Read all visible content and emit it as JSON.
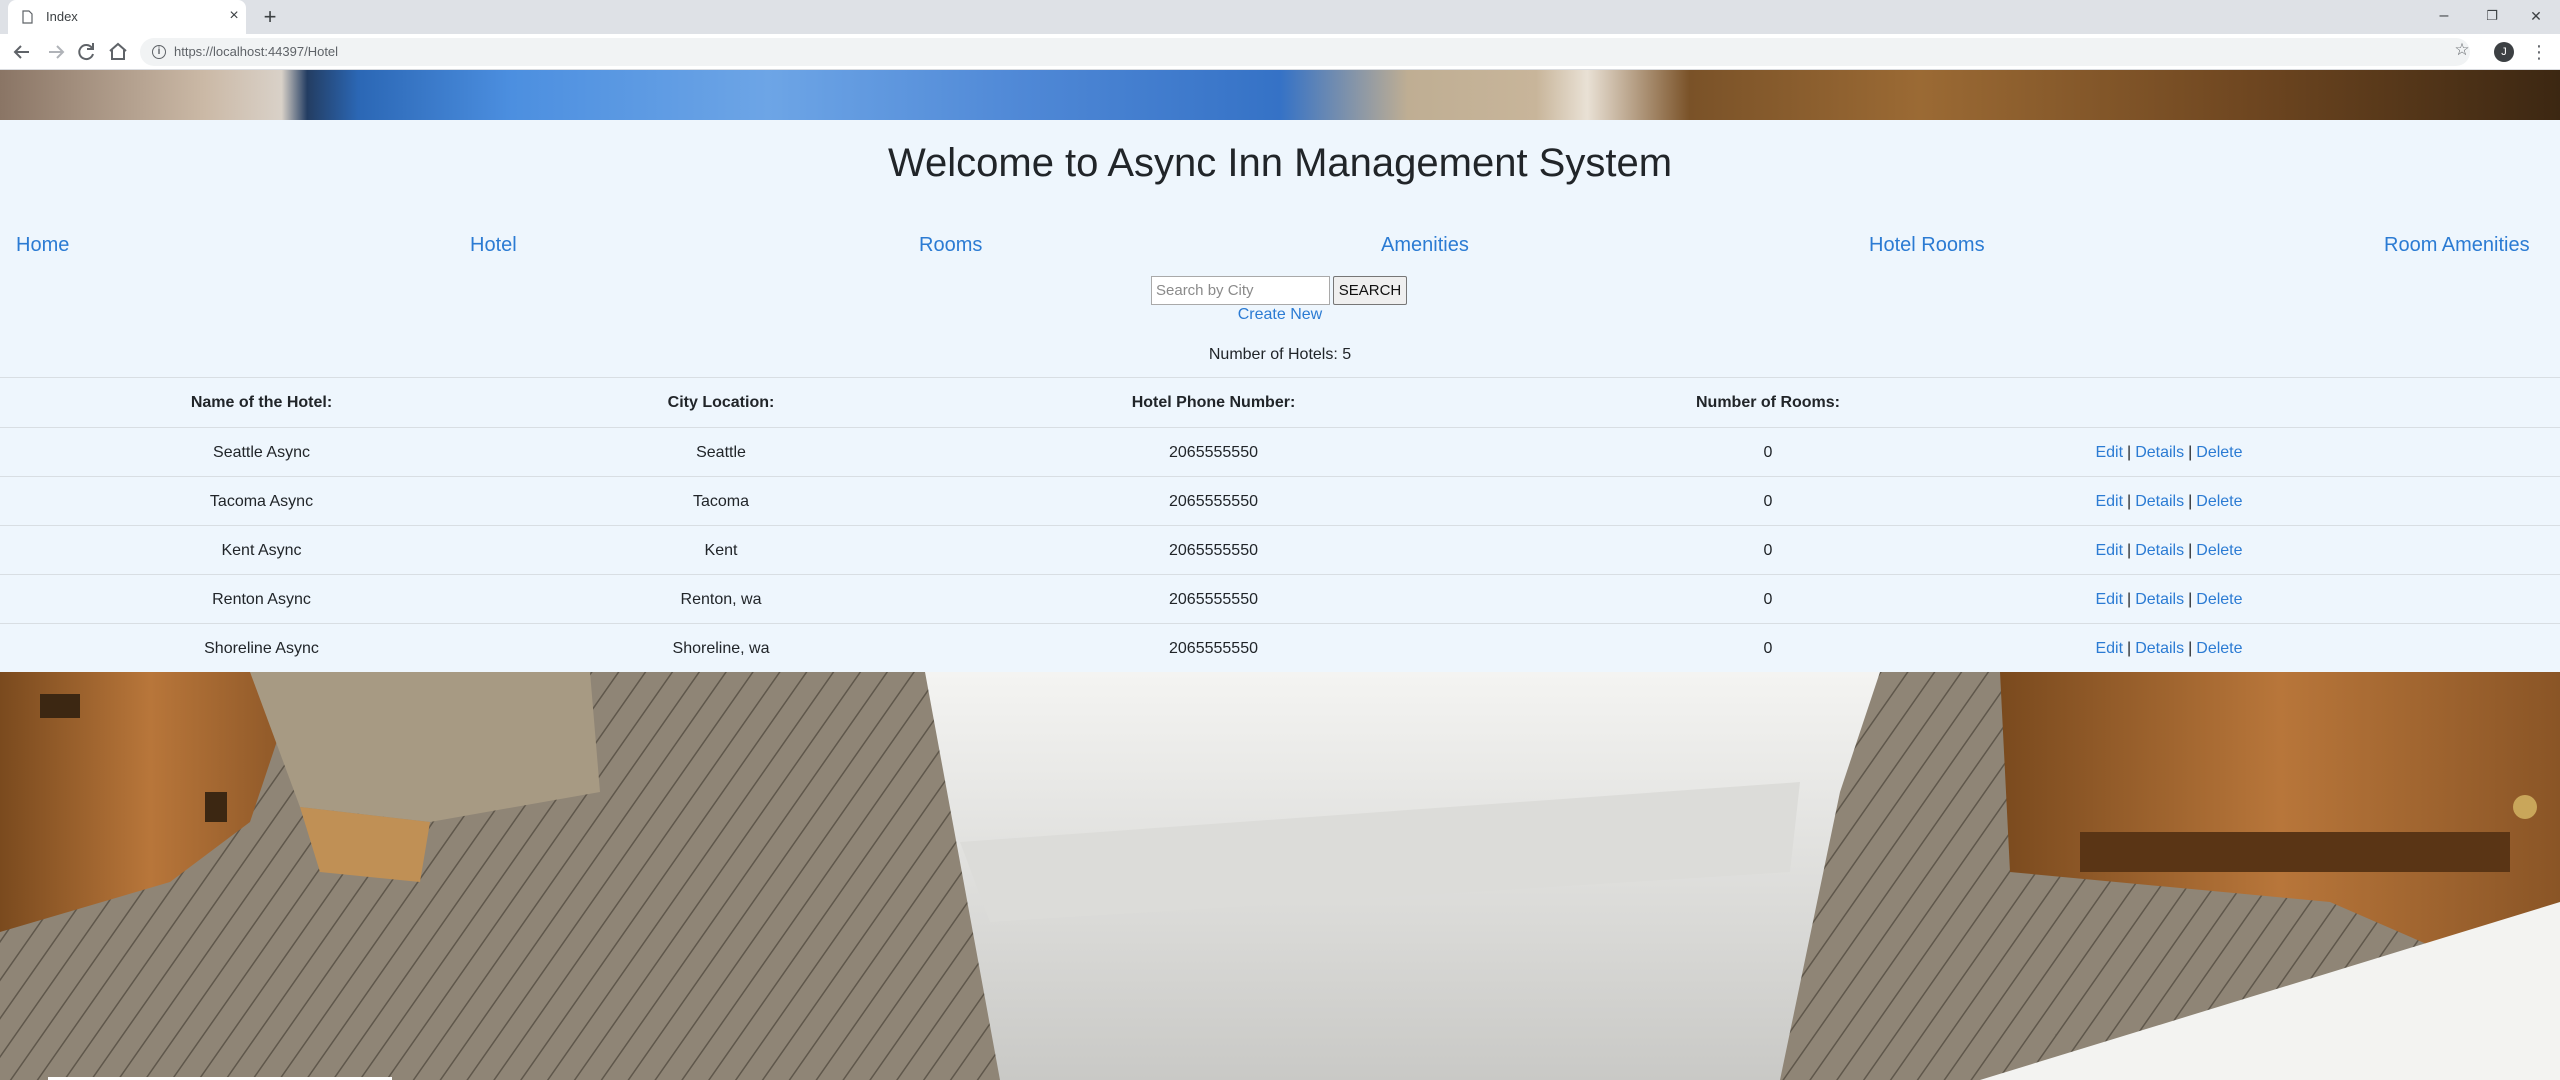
{
  "browser": {
    "tab_title": "Index",
    "tab_close": "×",
    "new_tab": "+",
    "url": "https://localhost:44397/Hotel",
    "profile_initial": "J",
    "window_controls": {
      "minimize": "–",
      "restore": "❐",
      "close": "✕"
    }
  },
  "page": {
    "title": "Welcome to Async Inn Management System",
    "nav": [
      {
        "label": "Home"
      },
      {
        "label": "Hotel"
      },
      {
        "label": "Rooms"
      },
      {
        "label": "Amenities"
      },
      {
        "label": "Hotel Rooms"
      },
      {
        "label": "Room Amenities"
      }
    ],
    "search": {
      "placeholder": "Search by City",
      "value": "",
      "button_label": "SEARCH"
    },
    "create_new": "Create New",
    "count_text": "Number of Hotels: 5",
    "table": {
      "headers": [
        "Name of the Hotel:",
        "City Location:",
        "Hotel Phone Number:",
        "Number of Rooms:"
      ],
      "rows": [
        {
          "name": "Seattle Async",
          "city": "Seattle",
          "phone": "2065555550",
          "rooms": "0"
        },
        {
          "name": "Tacoma Async",
          "city": "Tacoma",
          "phone": "2065555550",
          "rooms": "0"
        },
        {
          "name": "Kent Async",
          "city": "Kent",
          "phone": "2065555550",
          "rooms": "0"
        },
        {
          "name": "Renton Async",
          "city": "Renton, wa",
          "phone": "2065555550",
          "rooms": "0"
        },
        {
          "name": "Shoreline Async",
          "city": "Shoreline, wa",
          "phone": "2065555550",
          "rooms": "0"
        }
      ],
      "actions": {
        "edit": "Edit",
        "details": "Details",
        "delete": "Delete",
        "separator": "|"
      }
    }
  },
  "colors": {
    "link": "#2b7bd3",
    "content_bg": "#eef6fd",
    "text": "#212529"
  }
}
